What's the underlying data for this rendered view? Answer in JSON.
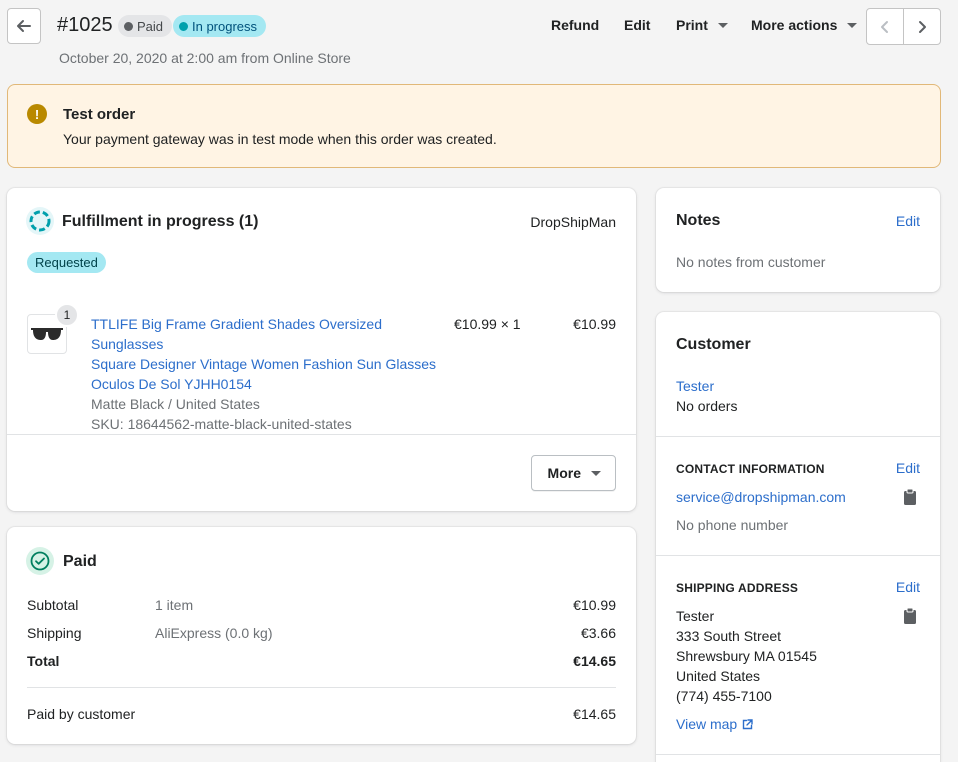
{
  "header": {
    "order_number": "#1025",
    "badge_paid": "Paid",
    "badge_status": "In progress",
    "subtitle": "October 20, 2020 at 2:00 am from Online Store",
    "actions": {
      "refund": "Refund",
      "edit": "Edit",
      "print": "Print",
      "more": "More actions"
    }
  },
  "banner": {
    "icon_text": "!",
    "title": "Test order",
    "text": "Your payment gateway was in test mode when this order was created."
  },
  "fulfillment": {
    "title": "Fulfillment in progress (1)",
    "location": "DropShipMan",
    "status_badge": "Requested",
    "item": {
      "quantity_badge": "1",
      "name_line1": "TTLIFE Big Frame Gradient Shades Oversized Sunglasses",
      "name_line2": "Square Designer Vintage Women Fashion Sun Glasses",
      "name_line3": "Oculos De Sol YJHH0154",
      "variant": "Matte Black / United States",
      "sku": "SKU: 18644562-matte-black-united-states",
      "unit_price": "€10.99 × 1",
      "total": "€10.99"
    },
    "more_button": "More"
  },
  "payment": {
    "title": "Paid",
    "rows": [
      {
        "label": "Subtotal",
        "detail": "1 item",
        "amount": "€10.99"
      },
      {
        "label": "Shipping",
        "detail": "AliExpress (0.0 kg)",
        "amount": "€3.66"
      },
      {
        "label": "Total",
        "detail": "",
        "amount": "€14.65"
      }
    ],
    "paid_by_label": "Paid by customer",
    "paid_by_amount": "€14.65"
  },
  "notes": {
    "title": "Notes",
    "edit": "Edit",
    "text": "No notes from customer"
  },
  "customer": {
    "title": "Customer",
    "name": "Tester",
    "orders": "No orders",
    "contact": {
      "label": "CONTACT INFORMATION",
      "edit": "Edit",
      "email": "service@dropshipman.com",
      "phone": "No phone number"
    },
    "shipping": {
      "label": "SHIPPING ADDRESS",
      "edit": "Edit",
      "name": "Tester",
      "street": "333 South Street",
      "city": "Shrewsbury MA 01545",
      "country": "United States",
      "phone": "(774) 455-7100",
      "map_link": "View map"
    }
  },
  "icons": {
    "back": "arrow-left-icon",
    "prev": "chevron-left-icon",
    "next": "chevron-right-icon",
    "warning": "exclamation-circle-icon",
    "fulfillment": "progress-circle-icon",
    "paid": "check-circle-icon",
    "copy": "clipboard-icon",
    "external": "external-link-icon"
  },
  "colors": {
    "link": "#2c6ecb",
    "banner_bg": "#fff4e4",
    "banner_border": "#e1b878",
    "warning": "#b98900",
    "in_progress_badge": "#a4e8f2",
    "paid_icon": "#007f5f"
  }
}
